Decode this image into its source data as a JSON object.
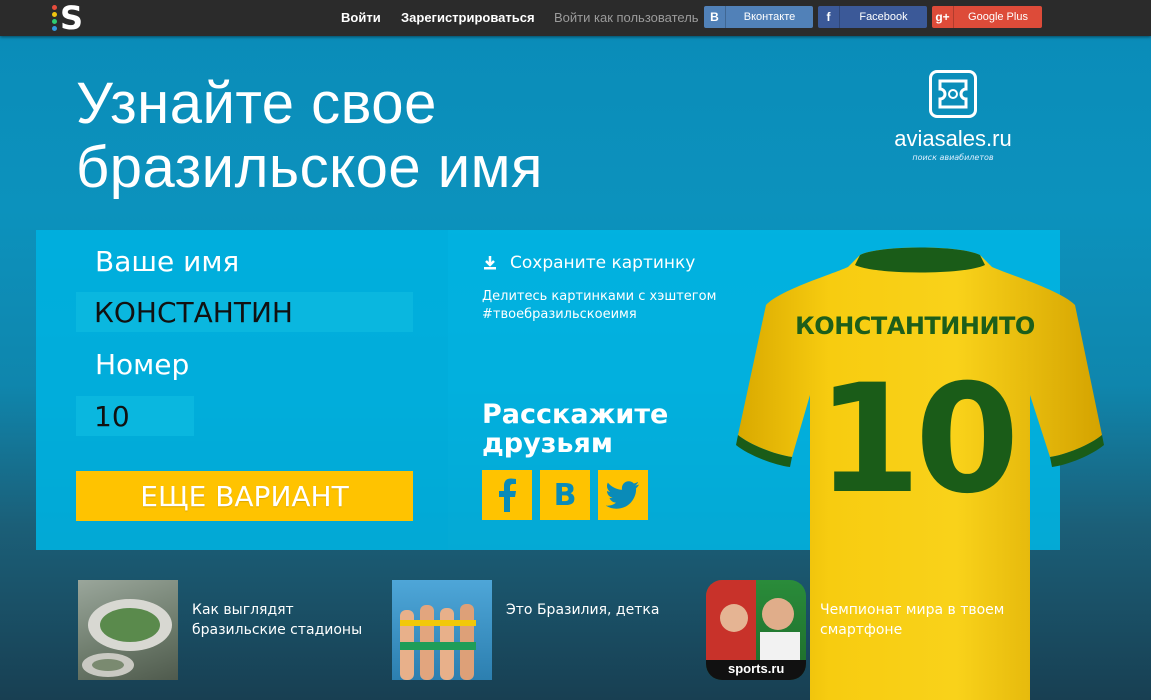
{
  "topbar": {
    "login": "Войти",
    "register": "Зарегистрироваться",
    "login_as": "Войти как пользователь",
    "vk_label": "Вконтакте",
    "fb_label": "Facebook",
    "gplus_label": "Google Plus",
    "logo_letter": "S"
  },
  "headline": {
    "line1": "Узнайте свое",
    "line2": "бразильское имя"
  },
  "brand": {
    "name": "aviasales.ru",
    "tagline": "поиск авиабилетов"
  },
  "form": {
    "name_label": "Ваше имя",
    "name_value": "КОНСТАНТИН",
    "number_label": "Номер",
    "number_value": "10",
    "cta": "ЕЩЕ ВАРИАНТ"
  },
  "share": {
    "save": "Сохраните картинку",
    "hashtag_line1": "Делитесь картинками с хэштегом",
    "hashtag_line2": "#твоебразильскоеимя",
    "tell_line1": "Расскажите",
    "tell_line2": "друзьям"
  },
  "jersey": {
    "name": "КОНСТАНТИНИТО",
    "number": "10"
  },
  "bottom": {
    "items": [
      {
        "line1": "Как выглядят",
        "line2": "бразильские стадионы"
      },
      {
        "line1": "Это Бразилия, детка",
        "line2": ""
      },
      {
        "line1": "Чемпионат мира в твоем",
        "line2": "смартфоне",
        "badge": "sports.ru"
      }
    ]
  },
  "colors": {
    "accent": "#ffc300",
    "panel": "#00b7e6",
    "jersey": "#f5c400",
    "jersey_text": "#1a5c18",
    "vk": "#5181b8",
    "fb": "#3b5998",
    "gplus": "#dd4b39"
  }
}
